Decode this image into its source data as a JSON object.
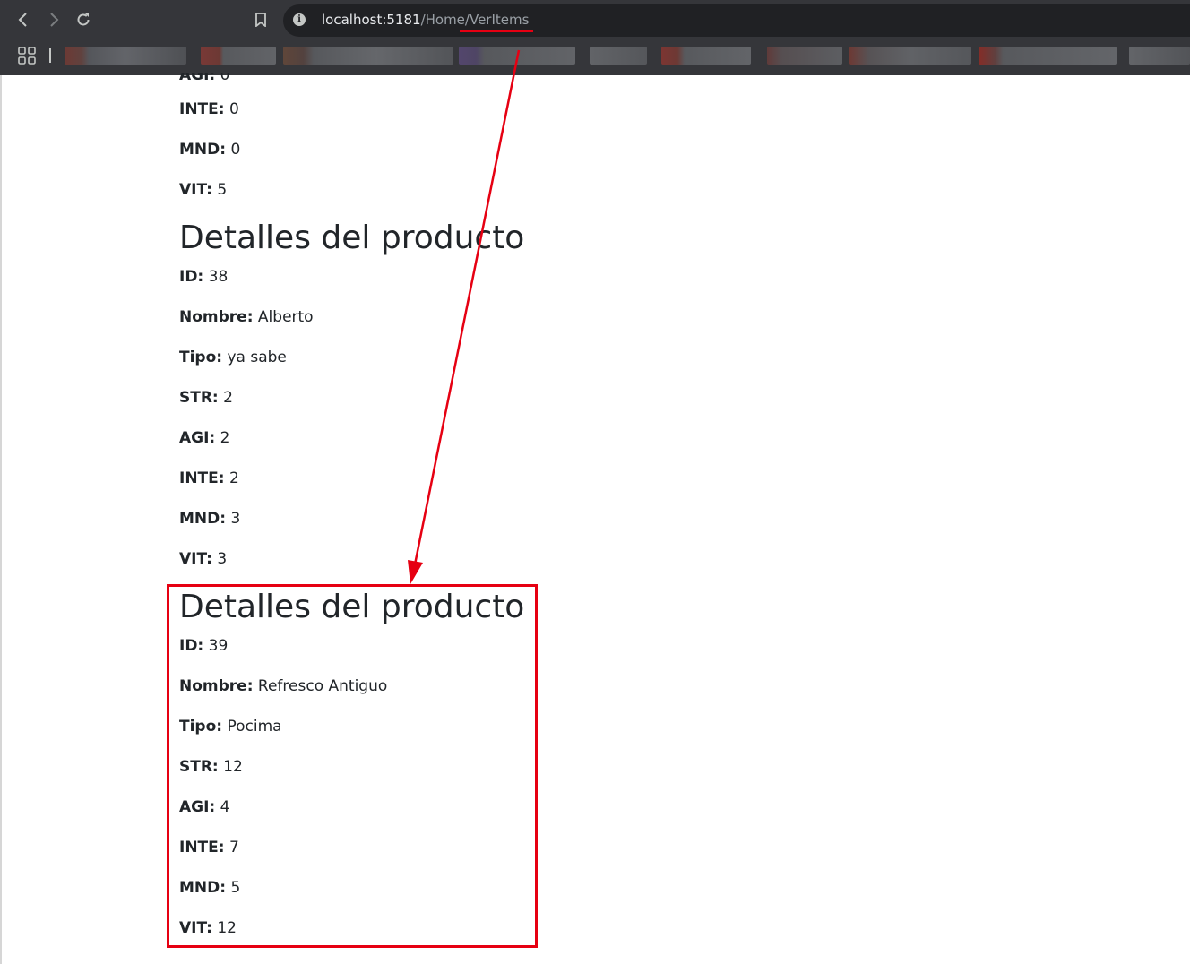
{
  "browser": {
    "url_host": "localhost:5181",
    "url_path": "/Home/VerItems"
  },
  "sections": [
    {
      "partial": true,
      "fields": [
        {
          "label": "INTE:",
          "value": "0"
        },
        {
          "label": "MND:",
          "value": "0"
        },
        {
          "label": "VIT:",
          "value": "5"
        }
      ]
    },
    {
      "title": "Detalles del producto",
      "fields": [
        {
          "label": "ID:",
          "value": "38"
        },
        {
          "label": "Nombre:",
          "value": "Alberto"
        },
        {
          "label": "Tipo:",
          "value": "ya sabe"
        },
        {
          "label": "STR:",
          "value": "2"
        },
        {
          "label": "AGI:",
          "value": "2"
        },
        {
          "label": "INTE:",
          "value": "2"
        },
        {
          "label": "MND:",
          "value": "3"
        },
        {
          "label": "VIT:",
          "value": "3"
        }
      ]
    },
    {
      "title": "Detalles del producto",
      "fields": [
        {
          "label": "ID:",
          "value": "39"
        },
        {
          "label": "Nombre:",
          "value": "Refresco Antiguo"
        },
        {
          "label": "Tipo:",
          "value": "Pocima"
        },
        {
          "label": "STR:",
          "value": "12"
        },
        {
          "label": "AGI:",
          "value": "4"
        },
        {
          "label": "INTE:",
          "value": "7"
        },
        {
          "label": "MND:",
          "value": "5"
        },
        {
          "label": "VIT:",
          "value": "12"
        }
      ]
    }
  ],
  "colors": {
    "annotation": "#e60012",
    "chrome": "#35363a",
    "omnibox": "#202124"
  }
}
